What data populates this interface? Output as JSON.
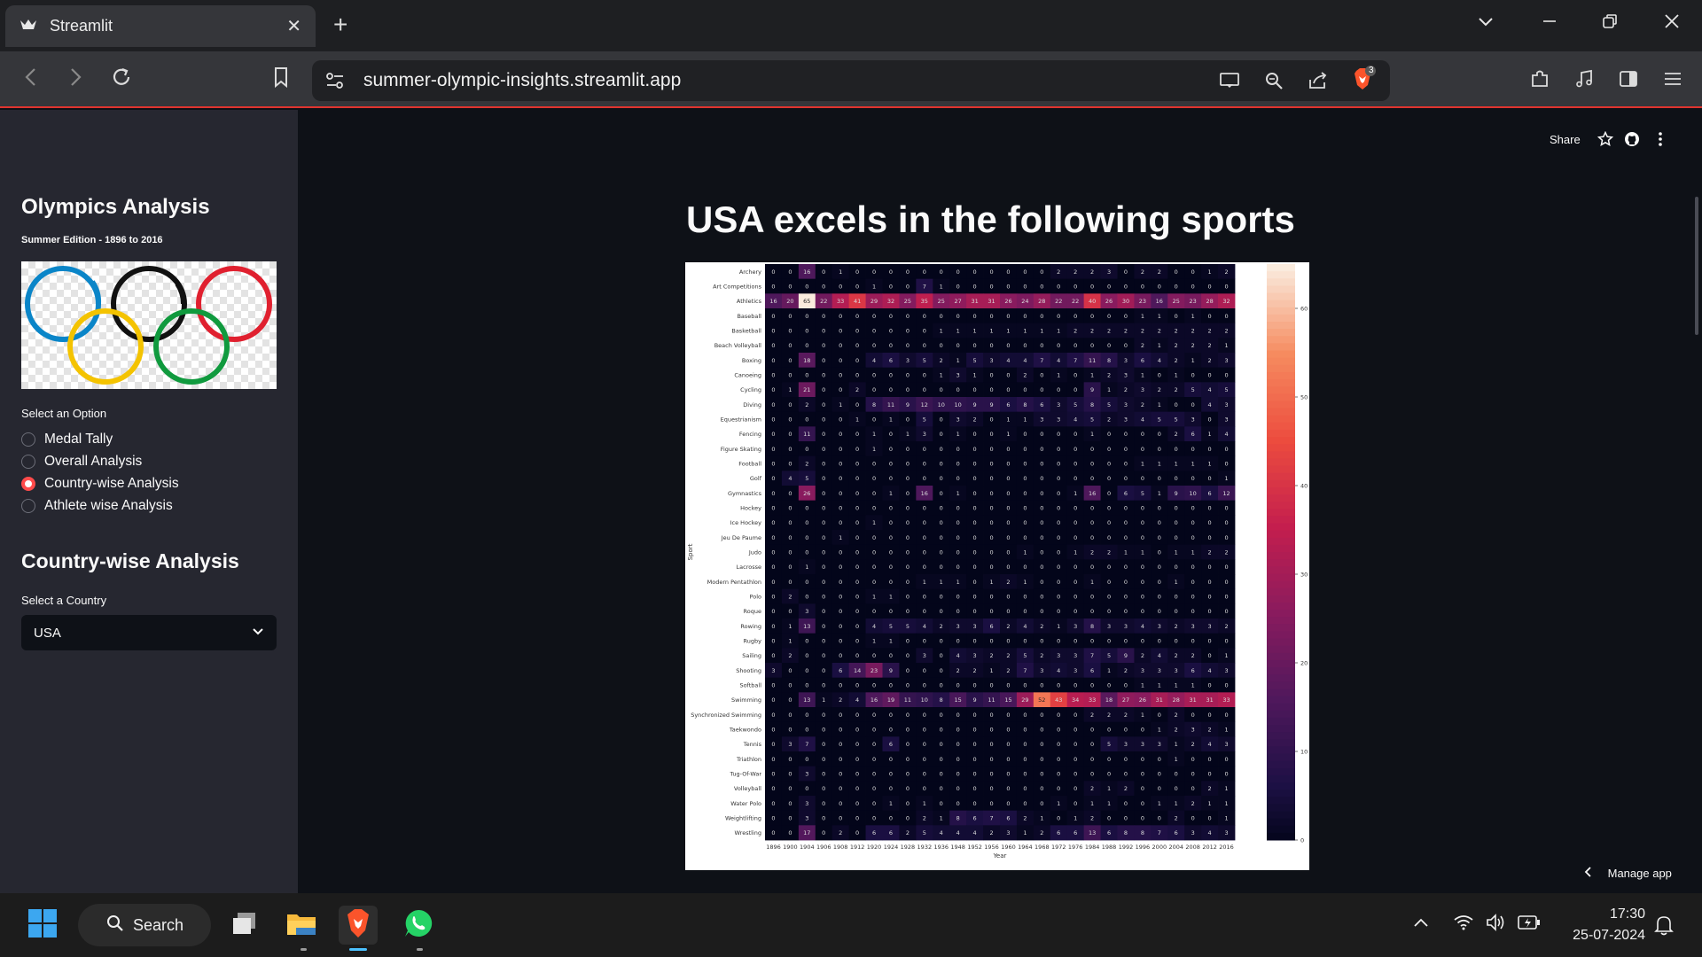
{
  "browser": {
    "tab_title": "Streamlit",
    "url": "summer-olympic-insights.streamlit.app",
    "brave_badge": "3"
  },
  "sidebar": {
    "title": "Olympics Analysis",
    "subtitle": "Summer Edition - 1896 to 2016",
    "option_label": "Select an Option",
    "options": [
      "Medal Tally",
      "Overall Analysis",
      "Country-wise Analysis",
      "Athlete wise Analysis"
    ],
    "selected_option": "Country-wise Analysis",
    "section_title": "Country-wise Analysis",
    "country_label": "Select a Country",
    "country_value": "USA"
  },
  "header": {
    "share_label": "Share"
  },
  "main": {
    "title": "USA excels in the following sports",
    "manage_app_label": "Manage app"
  },
  "chart_data": {
    "type": "heatmap",
    "title": "",
    "xlabel": "Year",
    "ylabel": "Sport",
    "x": [
      1896,
      1900,
      1904,
      1906,
      1908,
      1912,
      1920,
      1924,
      1928,
      1932,
      1936,
      1948,
      1952,
      1956,
      1960,
      1964,
      1968,
      1972,
      1976,
      1984,
      1988,
      1992,
      1996,
      2000,
      2004,
      2008,
      2012,
      2016
    ],
    "y": [
      "Archery",
      "Art Competitions",
      "Athletics",
      "Baseball",
      "Basketball",
      "Beach Volleyball",
      "Boxing",
      "Canoeing",
      "Cycling",
      "Diving",
      "Equestrianism",
      "Fencing",
      "Figure Skating",
      "Football",
      "Golf",
      "Gymnastics",
      "Hockey",
      "Ice Hockey",
      "Jeu De Paume",
      "Judo",
      "Lacrosse",
      "Modern Pentathlon",
      "Polo",
      "Roque",
      "Rowing",
      "Rugby",
      "Sailing",
      "Shooting",
      "Softball",
      "Swimming",
      "Synchronized Swimming",
      "Taekwondo",
      "Tennis",
      "Triathlon",
      "Tug-Of-War",
      "Volleyball",
      "Water Polo",
      "Weightlifting",
      "Wrestling"
    ],
    "values": [
      [
        0,
        0,
        16,
        0,
        1,
        0,
        0,
        0,
        0,
        0,
        0,
        0,
        0,
        0,
        0,
        0,
        0,
        2,
        2,
        2,
        3,
        0,
        2,
        2,
        0,
        0,
        1,
        2
      ],
      [
        0,
        0,
        0,
        0,
        0,
        0,
        1,
        0,
        0,
        7,
        1,
        0,
        0,
        0,
        0,
        0,
        0,
        0,
        0,
        0,
        0,
        0,
        0,
        0,
        0,
        0,
        0,
        0
      ],
      [
        16,
        20,
        65,
        22,
        33,
        41,
        29,
        32,
        25,
        35,
        25,
        27,
        31,
        31,
        26,
        24,
        28,
        22,
        22,
        40,
        26,
        30,
        23,
        16,
        25,
        23,
        28,
        32
      ],
      [
        0,
        0,
        0,
        0,
        0,
        0,
        0,
        0,
        0,
        0,
        0,
        0,
        0,
        0,
        0,
        0,
        0,
        0,
        0,
        0,
        0,
        0,
        1,
        1,
        0,
        1,
        0,
        0
      ],
      [
        0,
        0,
        0,
        0,
        0,
        0,
        0,
        0,
        0,
        0,
        1,
        1,
        1,
        1,
        1,
        1,
        1,
        1,
        2,
        2,
        2,
        2,
        2,
        2,
        2,
        2,
        2,
        2
      ],
      [
        0,
        0,
        0,
        0,
        0,
        0,
        0,
        0,
        0,
        0,
        0,
        0,
        0,
        0,
        0,
        0,
        0,
        0,
        0,
        0,
        0,
        0,
        2,
        1,
        2,
        2,
        2,
        1
      ],
      [
        0,
        0,
        18,
        0,
        0,
        0,
        4,
        6,
        3,
        5,
        2,
        1,
        5,
        3,
        4,
        4,
        7,
        4,
        7,
        11,
        8,
        3,
        6,
        4,
        2,
        1,
        2,
        3
      ],
      [
        0,
        0,
        0,
        0,
        0,
        0,
        0,
        0,
        0,
        0,
        1,
        3,
        1,
        0,
        0,
        2,
        0,
        1,
        0,
        1,
        2,
        3,
        1,
        0,
        1,
        0,
        0,
        0
      ],
      [
        0,
        1,
        21,
        0,
        0,
        2,
        0,
        0,
        0,
        0,
        0,
        0,
        0,
        0,
        0,
        0,
        0,
        0,
        0,
        9,
        1,
        2,
        3,
        2,
        2,
        5,
        4,
        5
      ],
      [
        0,
        0,
        2,
        0,
        1,
        0,
        8,
        11,
        9,
        12,
        10,
        10,
        9,
        9,
        6,
        8,
        6,
        3,
        5,
        8,
        5,
        3,
        2,
        1,
        0,
        0,
        4,
        3
      ],
      [
        0,
        0,
        0,
        0,
        0,
        1,
        0,
        1,
        0,
        5,
        0,
        3,
        2,
        0,
        1,
        1,
        3,
        3,
        4,
        5,
        2,
        3,
        4,
        5,
        5,
        3,
        0,
        3
      ],
      [
        0,
        0,
        11,
        0,
        0,
        0,
        1,
        0,
        1,
        3,
        0,
        1,
        0,
        0,
        1,
        0,
        0,
        0,
        0,
        1,
        0,
        0,
        0,
        0,
        2,
        6,
        1,
        4
      ],
      [
        0,
        0,
        0,
        0,
        0,
        0,
        1,
        0,
        0,
        0,
        0,
        0,
        0,
        0,
        0,
        0,
        0,
        0,
        0,
        0,
        0,
        0,
        0,
        0,
        0,
        0,
        0,
        0
      ],
      [
        0,
        0,
        2,
        0,
        0,
        0,
        0,
        0,
        0,
        0,
        0,
        0,
        0,
        0,
        0,
        0,
        0,
        0,
        0,
        0,
        0,
        0,
        1,
        1,
        1,
        1,
        1,
        0
      ],
      [
        0,
        4,
        5,
        0,
        0,
        0,
        0,
        0,
        0,
        0,
        0,
        0,
        0,
        0,
        0,
        0,
        0,
        0,
        0,
        0,
        0,
        0,
        0,
        0,
        0,
        0,
        0,
        1
      ],
      [
        0,
        0,
        26,
        0,
        0,
        0,
        0,
        1,
        0,
        16,
        0,
        1,
        0,
        0,
        0,
        0,
        0,
        0,
        1,
        16,
        0,
        6,
        5,
        1,
        9,
        10,
        6,
        12
      ],
      [
        0,
        0,
        0,
        0,
        0,
        0,
        0,
        0,
        0,
        0,
        0,
        0,
        0,
        0,
        0,
        0,
        0,
        0,
        0,
        0,
        0,
        0,
        0,
        0,
        0,
        0,
        0,
        0
      ],
      [
        0,
        0,
        0,
        0,
        0,
        0,
        1,
        0,
        0,
        0,
        0,
        0,
        0,
        0,
        0,
        0,
        0,
        0,
        0,
        0,
        0,
        0,
        0,
        0,
        0,
        0,
        0,
        0
      ],
      [
        0,
        0,
        0,
        0,
        1,
        0,
        0,
        0,
        0,
        0,
        0,
        0,
        0,
        0,
        0,
        0,
        0,
        0,
        0,
        0,
        0,
        0,
        0,
        0,
        0,
        0,
        0,
        0
      ],
      [
        0,
        0,
        0,
        0,
        0,
        0,
        0,
        0,
        0,
        0,
        0,
        0,
        0,
        0,
        0,
        1,
        0,
        0,
        1,
        2,
        2,
        1,
        1,
        0,
        1,
        1,
        2,
        2
      ],
      [
        0,
        0,
        1,
        0,
        0,
        0,
        0,
        0,
        0,
        0,
        0,
        0,
        0,
        0,
        0,
        0,
        0,
        0,
        0,
        0,
        0,
        0,
        0,
        0,
        0,
        0,
        0,
        0
      ],
      [
        0,
        0,
        0,
        0,
        0,
        0,
        0,
        0,
        0,
        1,
        1,
        1,
        0,
        1,
        2,
        1,
        0,
        0,
        0,
        1,
        0,
        0,
        0,
        0,
        1,
        0,
        0,
        0
      ],
      [
        0,
        2,
        0,
        0,
        0,
        0,
        1,
        1,
        0,
        0,
        0,
        0,
        0,
        0,
        0,
        0,
        0,
        0,
        0,
        0,
        0,
        0,
        0,
        0,
        0,
        0,
        0,
        0
      ],
      [
        0,
        0,
        3,
        0,
        0,
        0,
        0,
        0,
        0,
        0,
        0,
        0,
        0,
        0,
        0,
        0,
        0,
        0,
        0,
        0,
        0,
        0,
        0,
        0,
        0,
        0,
        0,
        0
      ],
      [
        0,
        1,
        13,
        0,
        0,
        0,
        4,
        5,
        5,
        4,
        2,
        3,
        3,
        6,
        2,
        4,
        2,
        1,
        3,
        8,
        3,
        3,
        4,
        3,
        2,
        3,
        3,
        2
      ],
      [
        0,
        1,
        0,
        0,
        0,
        0,
        1,
        1,
        0,
        0,
        0,
        0,
        0,
        0,
        0,
        0,
        0,
        0,
        0,
        0,
        0,
        0,
        0,
        0,
        0,
        0,
        0,
        0
      ],
      [
        0,
        2,
        0,
        0,
        0,
        0,
        0,
        0,
        0,
        3,
        0,
        4,
        3,
        2,
        2,
        5,
        2,
        3,
        3,
        7,
        5,
        9,
        2,
        4,
        2,
        2,
        0,
        1
      ],
      [
        3,
        0,
        0,
        0,
        6,
        14,
        23,
        9,
        0,
        0,
        0,
        2,
        2,
        1,
        2,
        7,
        3,
        4,
        3,
        6,
        1,
        2,
        3,
        3,
        3,
        6,
        4,
        3
      ],
      [
        0,
        0,
        0,
        0,
        0,
        0,
        0,
        0,
        0,
        0,
        0,
        0,
        0,
        0,
        0,
        0,
        0,
        0,
        0,
        0,
        0,
        0,
        1,
        1,
        1,
        1,
        0,
        0
      ],
      [
        0,
        0,
        13,
        1,
        2,
        4,
        16,
        19,
        11,
        10,
        8,
        15,
        9,
        11,
        15,
        29,
        52,
        43,
        34,
        33,
        18,
        27,
        26,
        31,
        28,
        31,
        31,
        33
      ],
      [
        0,
        0,
        0,
        0,
        0,
        0,
        0,
        0,
        0,
        0,
        0,
        0,
        0,
        0,
        0,
        0,
        0,
        0,
        0,
        2,
        2,
        2,
        1,
        0,
        2,
        0,
        0,
        0
      ],
      [
        0,
        0,
        0,
        0,
        0,
        0,
        0,
        0,
        0,
        0,
        0,
        0,
        0,
        0,
        0,
        0,
        0,
        0,
        0,
        0,
        0,
        0,
        0,
        1,
        2,
        3,
        2,
        1
      ],
      [
        0,
        3,
        7,
        0,
        0,
        0,
        0,
        6,
        0,
        0,
        0,
        0,
        0,
        0,
        0,
        0,
        0,
        0,
        0,
        0,
        5,
        3,
        3,
        3,
        1,
        2,
        4,
        3
      ],
      [
        0,
        0,
        0,
        0,
        0,
        0,
        0,
        0,
        0,
        0,
        0,
        0,
        0,
        0,
        0,
        0,
        0,
        0,
        0,
        0,
        0,
        0,
        0,
        0,
        1,
        0,
        0,
        0
      ],
      [
        0,
        0,
        3,
        0,
        0,
        0,
        0,
        0,
        0,
        0,
        0,
        0,
        0,
        0,
        0,
        0,
        0,
        0,
        0,
        0,
        0,
        0,
        0,
        0,
        0,
        0,
        0,
        0
      ],
      [
        0,
        0,
        0,
        0,
        0,
        0,
        0,
        0,
        0,
        0,
        0,
        0,
        0,
        0,
        0,
        0,
        0,
        0,
        0,
        2,
        1,
        2,
        0,
        0,
        0,
        0,
        2,
        1
      ],
      [
        0,
        0,
        3,
        0,
        0,
        0,
        0,
        1,
        0,
        1,
        0,
        0,
        0,
        0,
        0,
        0,
        0,
        1,
        0,
        1,
        1,
        0,
        0,
        1,
        1,
        2,
        1,
        1
      ],
      [
        0,
        0,
        3,
        0,
        0,
        0,
        0,
        0,
        0,
        2,
        1,
        8,
        6,
        7,
        6,
        2,
        1,
        0,
        1,
        2,
        0,
        0,
        0,
        0,
        2,
        0,
        0,
        1
      ],
      [
        0,
        0,
        17,
        0,
        2,
        0,
        6,
        6,
        2,
        5,
        4,
        4,
        4,
        2,
        3,
        1,
        2,
        6,
        6,
        13,
        6,
        8,
        8,
        7,
        6,
        3,
        4,
        3
      ]
    ],
    "colorbar_ticks": [
      0,
      10,
      20,
      30,
      40,
      50,
      60
    ],
    "vmax": 65,
    "colormap": "rocket"
  },
  "taskbar": {
    "search_label": "Search",
    "time": "17:30",
    "date": "25-07-2024"
  },
  "colors": {
    "accent": "#ff4b4b",
    "sidebar_bg": "#262730",
    "main_bg": "#0e1117"
  }
}
